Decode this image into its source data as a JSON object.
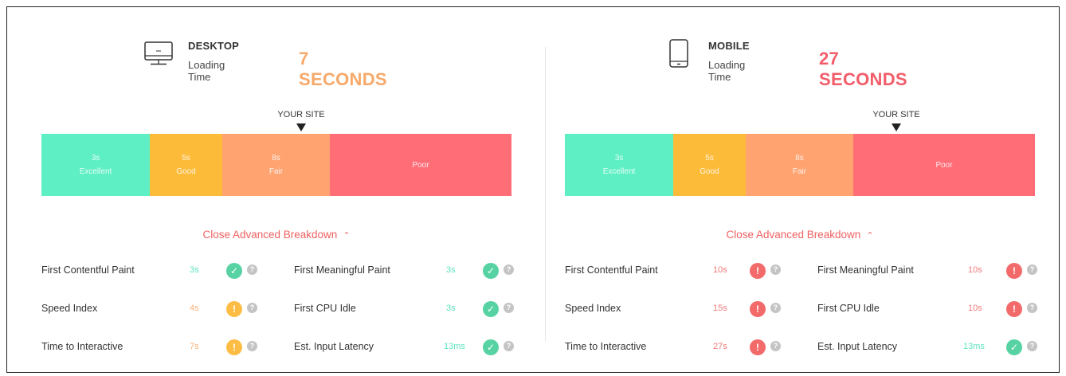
{
  "desktop": {
    "device": "DESKTOP",
    "subtitle": "Loading Time",
    "time": "7 SECONDS",
    "time_color": "#f7a96a",
    "marker_label": "YOUR SITE",
    "marker_value_seconds": 7,
    "segments": [
      {
        "time": "3s",
        "label": "Excellent"
      },
      {
        "time": "5s",
        "label": "Good"
      },
      {
        "time": "8s",
        "label": "Fair"
      },
      {
        "time": "",
        "label": "Poor"
      }
    ],
    "breakdown_label": "Close Advanced Breakdown",
    "metrics_left": [
      {
        "name": "First Contentful Paint",
        "value": "3s",
        "status": "ok"
      },
      {
        "name": "Speed Index",
        "value": "4s",
        "status": "warn"
      },
      {
        "name": "Time to Interactive",
        "value": "7s",
        "status": "warn"
      }
    ],
    "metrics_right": [
      {
        "name": "First Meaningful Paint",
        "value": "3s",
        "status": "ok"
      },
      {
        "name": "First CPU Idle",
        "value": "3s",
        "status": "ok"
      },
      {
        "name": "Est. Input Latency",
        "value": "13ms",
        "status": "ok"
      }
    ]
  },
  "mobile": {
    "device": "MOBILE",
    "subtitle": "Loading Time",
    "time": "27 SECONDS",
    "time_color": "#f25d6a",
    "marker_label": "YOUR SITE",
    "marker_value_seconds": 27,
    "segments": [
      {
        "time": "3s",
        "label": "Excellent"
      },
      {
        "time": "5s",
        "label": "Good"
      },
      {
        "time": "8s",
        "label": "Fair"
      },
      {
        "time": "",
        "label": "Poor"
      }
    ],
    "breakdown_label": "Close Advanced Breakdown",
    "metrics_left": [
      {
        "name": "First Contentful Paint",
        "value": "10s",
        "status": "bad"
      },
      {
        "name": "Speed Index",
        "value": "15s",
        "status": "bad"
      },
      {
        "name": "Time to Interactive",
        "value": "27s",
        "status": "bad"
      }
    ],
    "metrics_right": [
      {
        "name": "First Meaningful Paint",
        "value": "10s",
        "status": "bad"
      },
      {
        "name": "First CPU Idle",
        "value": "10s",
        "status": "bad"
      },
      {
        "name": "Est. Input Latency",
        "value": "13ms",
        "status": "ok"
      }
    ]
  },
  "icons": {
    "desktop": "monitor-icon",
    "mobile": "smartphone-icon",
    "ok": "check-circle-icon",
    "warn": "warning-circle-icon",
    "bad": "error-circle-icon",
    "help": "help-icon",
    "chevron": "chevron-up-icon"
  },
  "colors": {
    "excellent": "#5ef0c4",
    "good": "#fdbb3a",
    "fair": "#ffa371",
    "poor": "#ff6d77",
    "link": "#f06060"
  }
}
